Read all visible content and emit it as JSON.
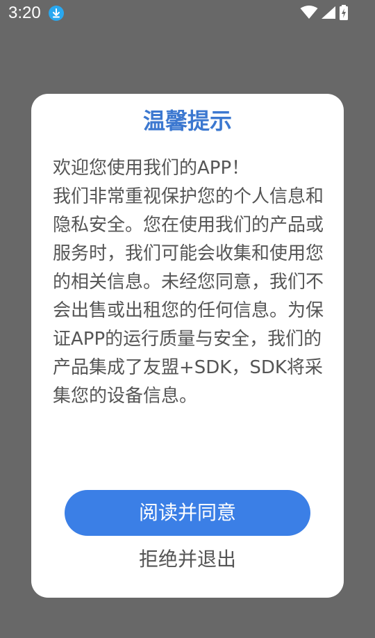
{
  "status_bar": {
    "time": "3:20",
    "icons": [
      "download-icon",
      "wifi-icon",
      "signal-icon",
      "battery-charging-icon"
    ]
  },
  "dialog": {
    "title": "温馨提示",
    "body": "欢迎您使用我们的APP！\n我们非常重视保护您的个人信息和隐私安全。您在使用我们的产品或服务时，我们可能会收集和使用您的相关信息。未经您同意，我们不会出售或出租您的任何信息。为保证APP的运行质量与安全，我们的产品集成了友盟+SDK，SDK将采集您的设备信息。",
    "agree_label": "阅读并同意",
    "reject_label": "拒绝并退出"
  },
  "colors": {
    "accent": "#3b7fe6",
    "title": "#3c78d0",
    "overlay": "#686868",
    "body_text": "#555555",
    "download_badge": "#29a8f0"
  }
}
